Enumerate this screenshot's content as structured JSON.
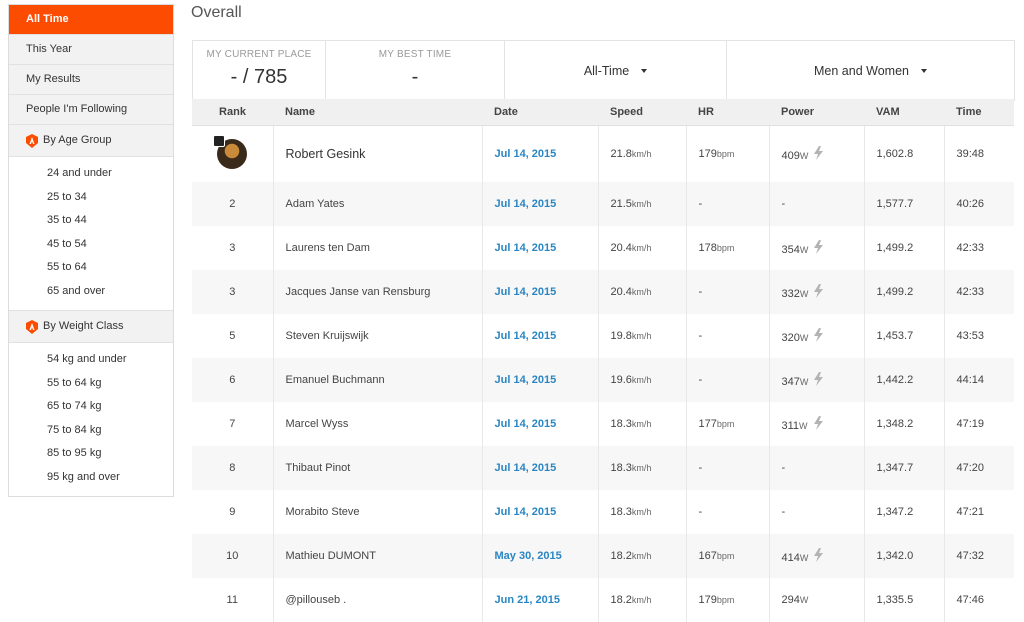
{
  "sidebar": {
    "items": [
      {
        "label": "All Time",
        "active": true
      },
      {
        "label": "This Year"
      },
      {
        "label": "My Results"
      },
      {
        "label": "People I'm Following"
      }
    ],
    "age_group": {
      "label": "By Age Group",
      "options": [
        "24 and under",
        "25 to 34",
        "35 to 44",
        "45 to 54",
        "55 to 64",
        "65 and over"
      ]
    },
    "weight_class": {
      "label": "By Weight Class",
      "options": [
        "54 kg and under",
        "55 to 64 kg",
        "65 to 74 kg",
        "75 to 84 kg",
        "85 to 95 kg",
        "95 kg and over"
      ]
    }
  },
  "page": {
    "title": "Overall"
  },
  "filters": {
    "current_place_label": "MY CURRENT PLACE",
    "current_place_value": "- / 785",
    "best_time_label": "MY BEST TIME",
    "best_time_value": "-",
    "timeframe": "All-Time",
    "gender": "Men and Women"
  },
  "table": {
    "headers": [
      "Rank",
      "Name",
      "Date",
      "Speed",
      "HR",
      "Power",
      "VAM",
      "Time"
    ],
    "rows": [
      {
        "rank": "",
        "name": "Robert Gesink",
        "date": "Jul 14, 2015",
        "speed": "21.8",
        "speed_unit": "km/h",
        "hr": "179",
        "hr_unit": "bpm",
        "power": "409",
        "power_unit": "W",
        "power_bolt": true,
        "vam": "1,602.8",
        "time": "39:48",
        "avatar": true
      },
      {
        "rank": "2",
        "name": "Adam Yates",
        "date": "Jul 14, 2015",
        "speed": "21.5",
        "speed_unit": "km/h",
        "hr": "-",
        "hr_unit": "",
        "power": "-",
        "power_unit": "",
        "power_bolt": false,
        "vam": "1,577.7",
        "time": "40:26"
      },
      {
        "rank": "3",
        "name": "Laurens ten Dam",
        "date": "Jul 14, 2015",
        "speed": "20.4",
        "speed_unit": "km/h",
        "hr": "178",
        "hr_unit": "bpm",
        "power": "354",
        "power_unit": "W",
        "power_bolt": true,
        "vam": "1,499.2",
        "time": "42:33"
      },
      {
        "rank": "3",
        "name": "Jacques Janse van Rensburg",
        "date": "Jul 14, 2015",
        "speed": "20.4",
        "speed_unit": "km/h",
        "hr": "-",
        "hr_unit": "",
        "power": "332",
        "power_unit": "W",
        "power_bolt": true,
        "vam": "1,499.2",
        "time": "42:33"
      },
      {
        "rank": "5",
        "name": "Steven Kruijswijk",
        "date": "Jul 14, 2015",
        "speed": "19.8",
        "speed_unit": "km/h",
        "hr": "-",
        "hr_unit": "",
        "power": "320",
        "power_unit": "W",
        "power_bolt": true,
        "vam": "1,453.7",
        "time": "43:53"
      },
      {
        "rank": "6",
        "name": "Emanuel Buchmann",
        "date": "Jul 14, 2015",
        "speed": "19.6",
        "speed_unit": "km/h",
        "hr": "-",
        "hr_unit": "",
        "power": "347",
        "power_unit": "W",
        "power_bolt": true,
        "vam": "1,442.2",
        "time": "44:14"
      },
      {
        "rank": "7",
        "name": "Marcel Wyss",
        "date": "Jul 14, 2015",
        "speed": "18.3",
        "speed_unit": "km/h",
        "hr": "177",
        "hr_unit": "bpm",
        "power": "311",
        "power_unit": "W",
        "power_bolt": true,
        "vam": "1,348.2",
        "time": "47:19"
      },
      {
        "rank": "8",
        "name": "Thibaut Pinot",
        "date": "Jul 14, 2015",
        "speed": "18.3",
        "speed_unit": "km/h",
        "hr": "-",
        "hr_unit": "",
        "power": "-",
        "power_unit": "",
        "power_bolt": false,
        "vam": "1,347.7",
        "time": "47:20"
      },
      {
        "rank": "9",
        "name": "Morabito Steve",
        "date": "Jul 14, 2015",
        "speed": "18.3",
        "speed_unit": "km/h",
        "hr": "-",
        "hr_unit": "",
        "power": "-",
        "power_unit": "",
        "power_bolt": false,
        "vam": "1,347.2",
        "time": "47:21"
      },
      {
        "rank": "10",
        "name": "Mathieu DUMONT",
        "date": "May 30, 2015",
        "speed": "18.2",
        "speed_unit": "km/h",
        "hr": "167",
        "hr_unit": "bpm",
        "power": "414",
        "power_unit": "W",
        "power_bolt": true,
        "vam": "1,342.0",
        "time": "47:32"
      },
      {
        "rank": "11",
        "name": "@pillouseb .",
        "date": "Jun 21, 2015",
        "speed": "18.2",
        "speed_unit": "km/h",
        "hr": "179",
        "hr_unit": "bpm",
        "power": "294",
        "power_unit": "W",
        "power_bolt": false,
        "vam": "1,335.5",
        "time": "47:46"
      }
    ]
  },
  "colors": {
    "accent": "#fc4c02",
    "link": "#2a86c3"
  }
}
